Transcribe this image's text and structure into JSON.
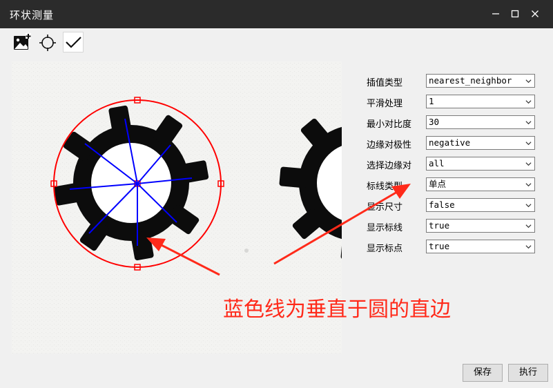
{
  "window": {
    "title": "环状测量",
    "minimize_icon": "minimize-icon",
    "maximize_icon": "maximize-icon",
    "close_icon": "close-icon"
  },
  "toolbar": {
    "icons": [
      "add-image-icon",
      "crosshair-circle-icon",
      "checkmark-icon"
    ]
  },
  "properties": [
    {
      "label": "插值类型",
      "value": "nearest_neighbor"
    },
    {
      "label": "平滑处理",
      "value": "1"
    },
    {
      "label": "最小对比度",
      "value": "30"
    },
    {
      "label": "边缘对极性",
      "value": "negative"
    },
    {
      "label": "选择边缘对",
      "value": "all"
    },
    {
      "label": "标线类型",
      "value": "单点"
    },
    {
      "label": "显示尺寸",
      "value": "false"
    },
    {
      "label": "显示标线",
      "value": "true"
    },
    {
      "label": "显示标点",
      "value": "true"
    }
  ],
  "buttons": {
    "save": "保存",
    "execute": "执行"
  },
  "annotation": {
    "text": "蓝色线为垂直于圆的直边"
  },
  "colors": {
    "titlebar": "#2b2b2b",
    "measure_circle": "#ff0000",
    "measure_lines": "#0000ff",
    "annotation": "#ff2a1a"
  }
}
